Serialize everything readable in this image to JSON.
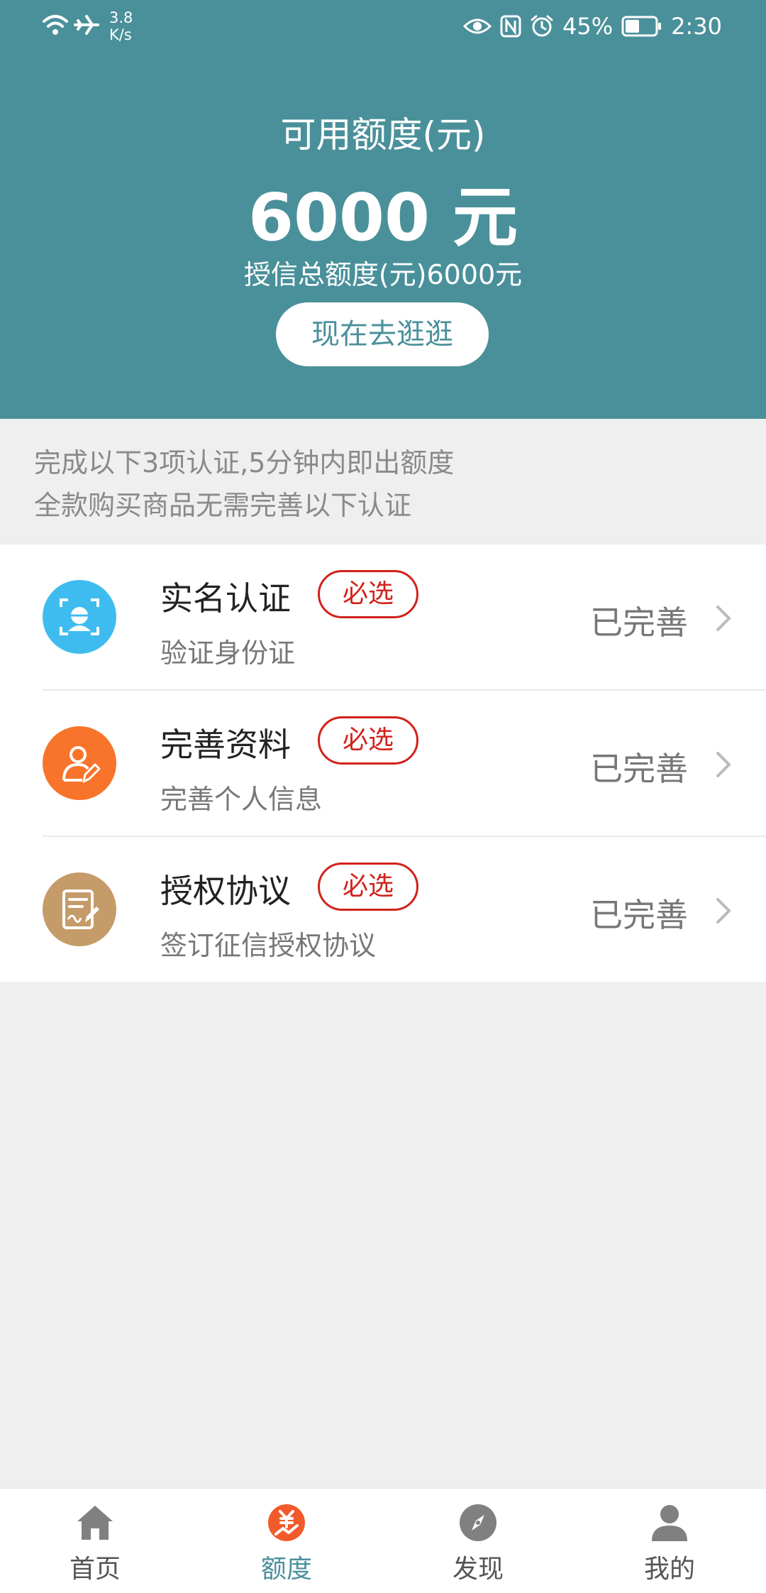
{
  "status_bar": {
    "speed_value": "3.8",
    "speed_unit": "K/s",
    "battery": "45%",
    "time": "2:30",
    "icons": [
      "wifi-icon",
      "airplane-icon",
      "eye-icon",
      "nfc-icon",
      "alarm-icon",
      "battery-icon"
    ]
  },
  "header": {
    "title": "可用额度(元)",
    "amount": "6000 元",
    "total": "授信总额度(元)6000元",
    "button": "现在去逛逛"
  },
  "tips": {
    "line1": "完成以下3项认证,5分钟内即出额度",
    "line2": "全款购买商品无需完善以下认证"
  },
  "items": [
    {
      "title": "实名认证",
      "badge": "必选",
      "subtitle": "验证身份证",
      "status": "已完善",
      "icon": "face-scan-icon",
      "color": "#3fbcef"
    },
    {
      "title": "完善资料",
      "badge": "必选",
      "subtitle": "完善个人信息",
      "status": "已完善",
      "icon": "user-edit-icon",
      "color": "#f7742a"
    },
    {
      "title": "授权协议",
      "badge": "必选",
      "subtitle": "签订征信授权协议",
      "status": "已完善",
      "icon": "contract-sign-icon",
      "color": "#c59b6a"
    }
  ],
  "tabs": [
    {
      "label": "首页",
      "icon": "home-icon"
    },
    {
      "label": "额度",
      "icon": "quota-yuan-icon",
      "active": true
    },
    {
      "label": "发现",
      "icon": "compass-icon"
    },
    {
      "label": "我的",
      "icon": "user-icon"
    }
  ],
  "colors": {
    "primary": "#4a909a",
    "required": "#d1221b",
    "background": "#efefef"
  }
}
